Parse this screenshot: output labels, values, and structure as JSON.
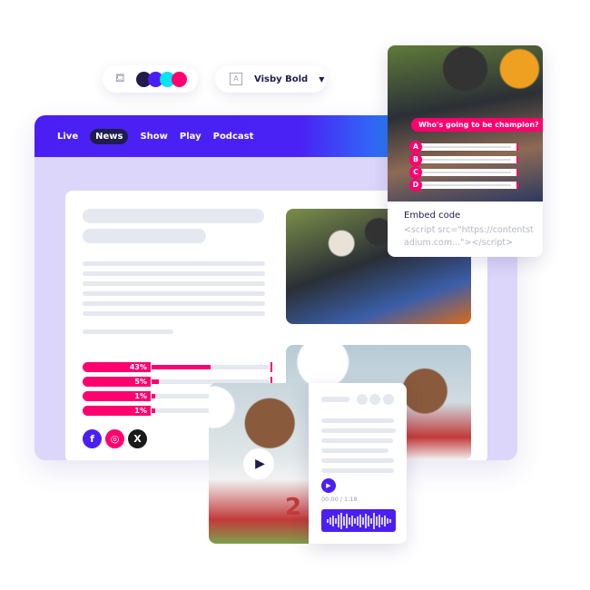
{
  "toolbar": {
    "paint_icon": "paint-bucket-icon",
    "swatches": [
      "#1f1d4d",
      "#4b1ff3",
      "#00e5ee",
      "#ff006e"
    ],
    "font_icon": "text-frame-icon",
    "font_name": "Visby Bold"
  },
  "nav": {
    "items": [
      "Live",
      "News",
      "Show",
      "Play",
      "Podcast"
    ],
    "active": "News"
  },
  "poll": [
    {
      "label": "43%",
      "value": 43
    },
    {
      "label": "5%",
      "value": 5
    },
    {
      "label": "1%",
      "value": 1
    },
    {
      "label": "1%",
      "value": 1
    }
  ],
  "social": [
    "f",
    "◎",
    "X"
  ],
  "quiz": {
    "question": "Who's going to be champion?",
    "options": [
      "A",
      "B",
      "C",
      "D"
    ],
    "embed_title": "Embed code",
    "embed_code": "<script src=\"https://contentstadium.com...\"></script>"
  },
  "video": {
    "jersey_number": "2"
  },
  "audio": {
    "time": "00:00 / 1:18"
  },
  "colors": {
    "accent": "#4b1ff3",
    "pink": "#ff006e",
    "navy": "#1f1d4d"
  }
}
